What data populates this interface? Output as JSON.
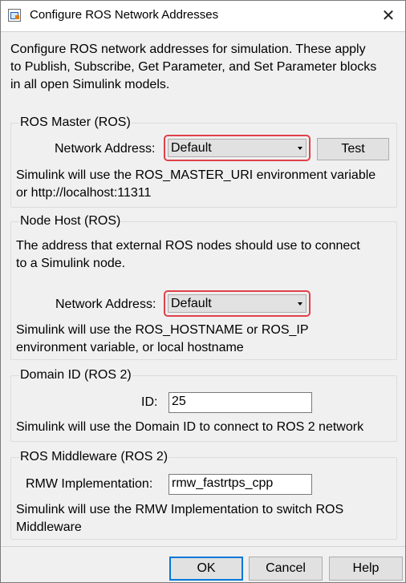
{
  "window": {
    "title": "Configure ROS Network Addresses",
    "close_glyph": "✕",
    "icon": "simulink-app-icon"
  },
  "intro": {
    "line1": "Configure ROS network addresses for simulation. These apply",
    "line2": "to Publish, Subscribe, Get Parameter, and Set Parameter blocks",
    "line3": "in all open Simulink models."
  },
  "ros_master": {
    "title": "ROS Master (ROS)",
    "network_label": "Network Address:",
    "network_value": "Default",
    "test_label": "Test",
    "desc_line1": "Simulink will use the ROS_MASTER_URI environment variable",
    "desc_line2": "or http://localhost:11311"
  },
  "node_host": {
    "title": "Node Host (ROS)",
    "intro_line1": "The address that external ROS nodes should use to connect",
    "intro_line2": "to a Simulink node.",
    "network_label": "Network Address:",
    "network_value": "Default",
    "desc_line1": "Simulink will use the ROS_HOSTNAME or ROS_IP",
    "desc_line2": "environment variable, or local hostname"
  },
  "domain_id": {
    "title": "Domain ID (ROS 2)",
    "id_label": "ID:",
    "id_value": "25",
    "desc": "Simulink will use the Domain ID to connect to ROS 2 network"
  },
  "middleware": {
    "title": "ROS Middleware (ROS 2)",
    "rmw_label": "RMW Implementation:",
    "rmw_value": "rmw_fastrtps_cpp",
    "desc_line1": "Simulink will use the RMW Implementation to switch ROS",
    "desc_line2": "Middleware"
  },
  "footer": {
    "ok_label": "OK",
    "cancel_label": "Cancel",
    "help_label": "Help"
  },
  "colors": {
    "highlight": "#e0404a",
    "dialog_bg": "#f0f0f0",
    "button_bg": "#e1e1e1",
    "focus_blue": "#0078d7"
  }
}
